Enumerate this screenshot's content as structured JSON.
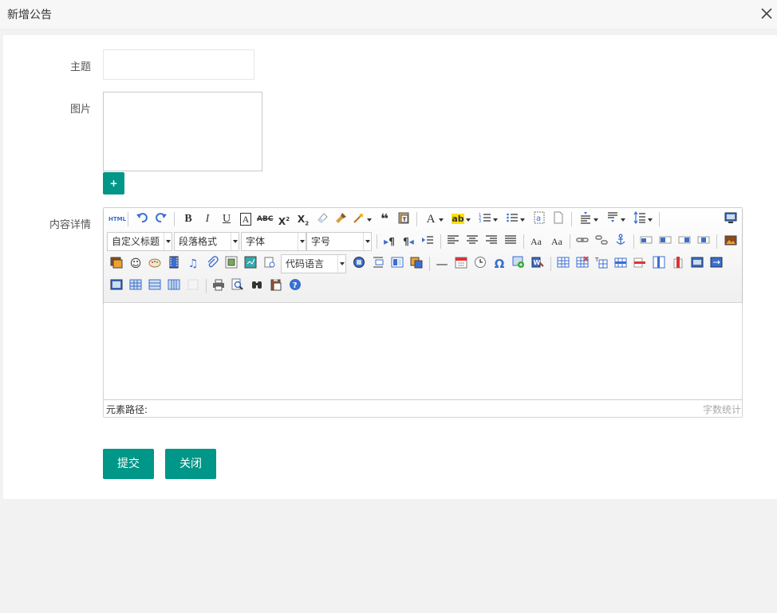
{
  "dialog": {
    "title": "新增公告",
    "close_icon": "close-icon"
  },
  "form": {
    "subject_label": "主题",
    "subject_value": "",
    "image_label": "图片",
    "add_image_label": "+",
    "content_label": "内容详情"
  },
  "editor": {
    "html_label": "HTML",
    "combos": {
      "custom_heading": "自定义标题",
      "paragraph_format": "段落格式",
      "font_family": "字体",
      "font_size": "字号",
      "code_language": "代码语言"
    },
    "status_path": "元素路径:",
    "status_count": "字数统计"
  },
  "actions": {
    "submit_label": "提交",
    "close_label": "关闭"
  },
  "colors": {
    "accent": "#009688"
  }
}
